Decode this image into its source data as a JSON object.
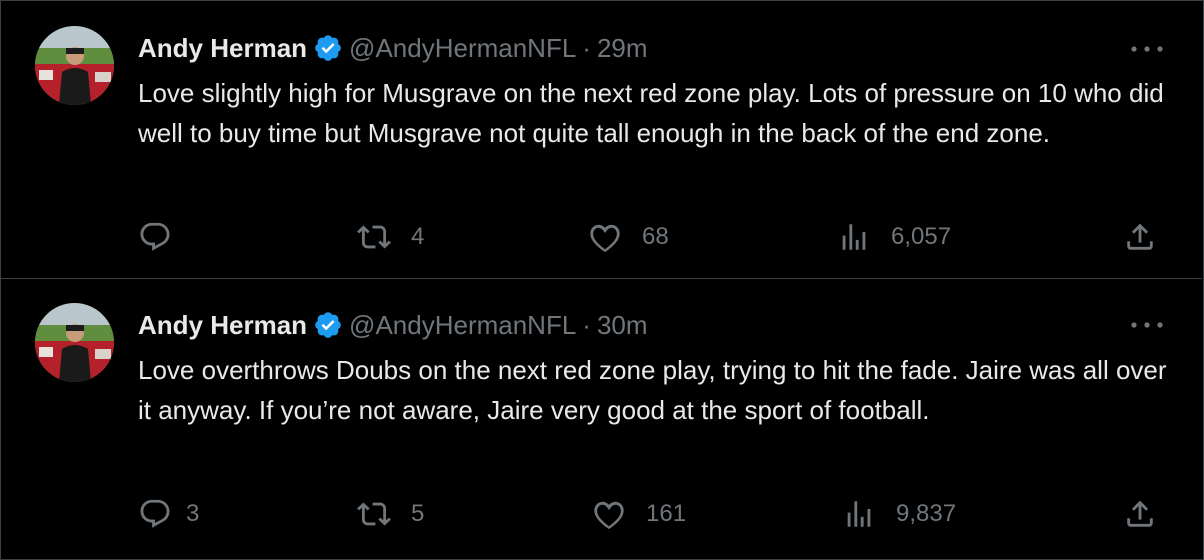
{
  "tweets": [
    {
      "name": "Andy Herman",
      "handle": "@AndyHermanNFL",
      "separator": "·",
      "time": "29m",
      "text": "Love slightly high for Musgrave on the next red zone play. Lots of pressure on 10 who did well to buy time but Musgrave not quite tall enough in the back of the end zone.",
      "replies": "",
      "retweets": "4",
      "likes": "68",
      "views": "6,057"
    },
    {
      "name": "Andy Herman",
      "handle": "@AndyHermanNFL",
      "separator": "·",
      "time": "30m",
      "text": "Love overthrows Doubs on the next red zone play, trying to hit the fade. Jaire was all over it anyway. If you’re not aware, Jaire very good at the sport of football.",
      "replies": "3",
      "retweets": "5",
      "likes": "161",
      "views": "9,837"
    }
  ],
  "icons": {
    "verified": "verified-badge-icon",
    "more": "more-dots-icon",
    "reply": "reply-icon",
    "retweet": "retweet-icon",
    "like": "heart-icon",
    "views": "views-icon",
    "share": "share-icon"
  },
  "colors": {
    "background": "#000000",
    "text": "#e7e9ea",
    "secondary": "#71767b",
    "verified": "#1d9bf0",
    "divider": "#3e4144"
  }
}
